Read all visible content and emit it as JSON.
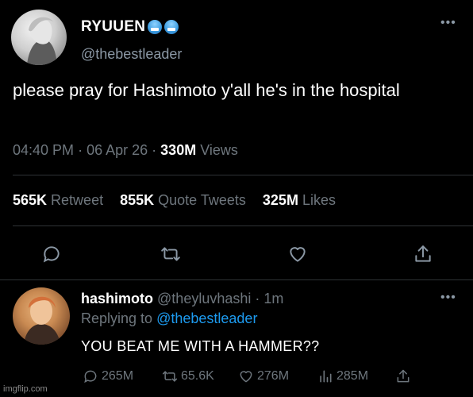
{
  "main_tweet": {
    "display_name": "RYUUEN",
    "handle": "@thebestleader",
    "text": "please pray for Hashimoto y'all he's in the hospital",
    "time": "04:40 PM",
    "sep1": "·",
    "date": "06 Apr 26",
    "sep2": "·",
    "views_count": "330M",
    "views_label": "Views",
    "more": "•••",
    "stats": {
      "retweets_count": "565K",
      "retweets_label": "Retweet",
      "quotes_count": "855K",
      "quotes_label": "Quote Tweets",
      "likes_count": "325M",
      "likes_label": "Likes"
    },
    "actions": [
      "reply-icon",
      "retweet-icon",
      "like-icon",
      "share-icon"
    ]
  },
  "reply_tweet": {
    "display_name": "hashimoto",
    "handle_time": "@theyluvhashi · 1m",
    "replying_prefix": "Replying to",
    "replying_handle": "@thebestleader",
    "text": "YOU BEAT ME WITH A HAMMER??",
    "more": "•••",
    "replies": "265M",
    "retweets": "65.6K",
    "likes": "276M",
    "views": "285M"
  },
  "watermark": "imgflip.com",
  "colors": {
    "background": "#000000",
    "muted": "#6e767d",
    "accent": "#1d9bf0"
  }
}
